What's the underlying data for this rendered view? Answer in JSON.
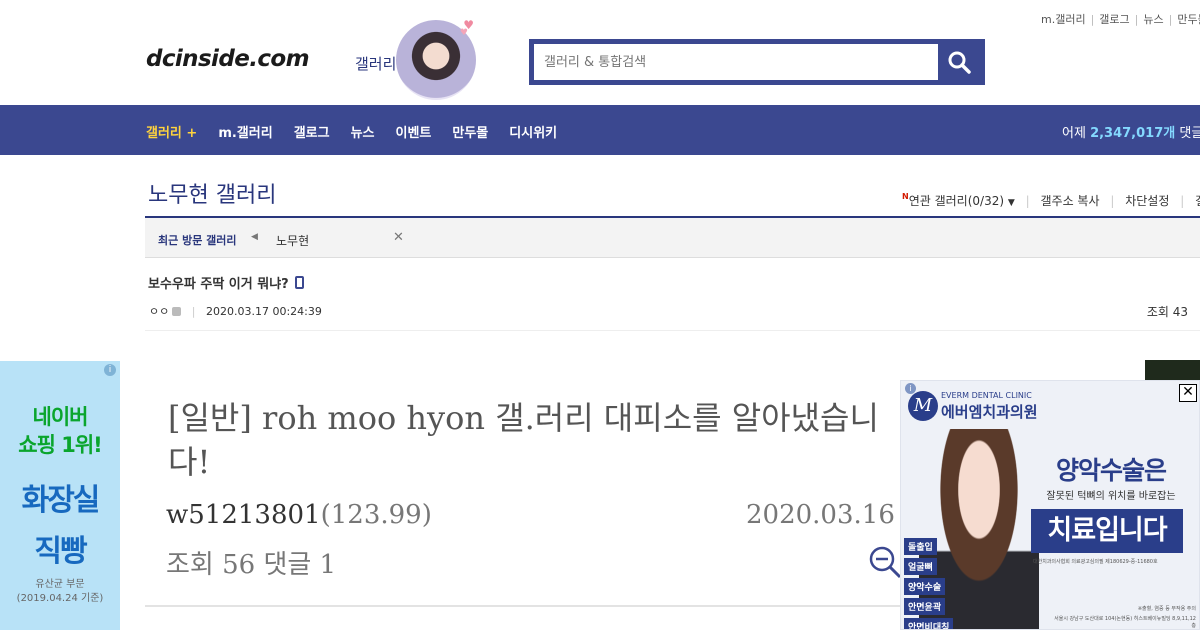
{
  "top_links": [
    "m.갤러리",
    "갤로그",
    "뉴스",
    "만두몰"
  ],
  "header": {
    "logo": "dcinside.com",
    "logo_sub": "갤러리",
    "search_placeholder": "갤러리 & 통합검색"
  },
  "nav": {
    "items": [
      "갤러리 +",
      "m.갤러리",
      "갤로그",
      "뉴스",
      "이벤트",
      "만두몰",
      "디시위키"
    ],
    "visitors_label": "어제",
    "visitors_count": "2,347,017개",
    "visitors_suffix": "댓글"
  },
  "gallery": {
    "title": "노무현 갤러리",
    "tools": {
      "related_label": "연관 갤러리(0/32)",
      "copy_address": "갤주소 복사",
      "block_settings": "차단설정",
      "gallery_info": "갤러"
    },
    "recent_label": "최근 방문 갤러리",
    "recent_item": "노무현"
  },
  "post": {
    "title": "보수우파 주딱 이거 뭐냐?",
    "nickname": "ㅇㅇ",
    "date": "2020.03.17 00:24:39",
    "views": "조회 43"
  },
  "embed": {
    "title": "[일반] roh moo hyon 갤.러리 대피소를 알아냈습니다!",
    "author": "w51213801",
    "ip": "(123.99)",
    "date": "2020.03.16",
    "stats": "조회 56 댓글 1"
  },
  "left_ad": {
    "line1": "네이버",
    "line2": "쇼핑 1위!",
    "line3": "화장실",
    "line4": "직빵",
    "foot1": "유산균 부문",
    "foot2": "(2019.04.24 기준)"
  },
  "right_ad": {
    "clinic_en": "EVERM DENTAL CLINIC",
    "clinic_ko": "에버엠치과의원",
    "head1": "양악수술은",
    "head2": "잘못된 턱뼈의 위치를 바로잡는",
    "head3": "치료입니다",
    "small1": "대한치과의사협회 의료광고심의필 제180629-중-11680호",
    "small2": "※출혈, 염증 등 부작용 주의",
    "small3": "서울시 강남구 도산대로 104(논현동) 히스트베이뉴빌딩 8,9,11,12층",
    "tags": [
      "돌출입",
      "얼굴뼈",
      "양악수술",
      "안면윤곽",
      "안면비대칭"
    ]
  },
  "colors": {
    "brand_blue": "#3b4890",
    "nav_active": "#ffd33d",
    "visitor_count": "#84d9ff"
  }
}
